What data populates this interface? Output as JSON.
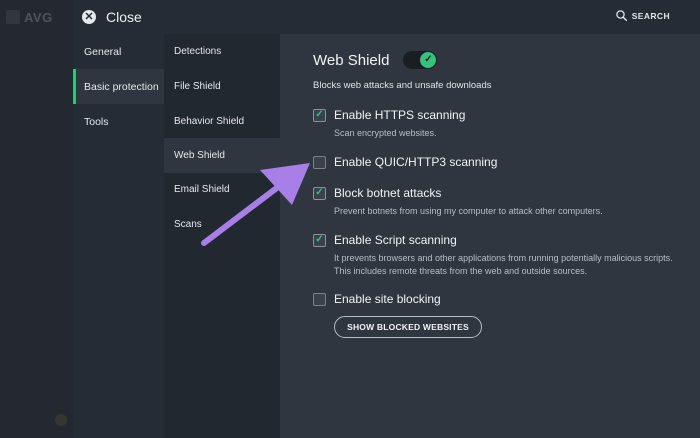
{
  "background": {
    "logo_text": "AVG"
  },
  "topbar": {
    "close_label": "Close",
    "search_label": "SEARCH"
  },
  "categories": [
    {
      "label": "General",
      "active": false
    },
    {
      "label": "Basic protection",
      "active": true
    },
    {
      "label": "Tools",
      "active": false
    }
  ],
  "subitems": [
    {
      "label": "Detections",
      "active": false
    },
    {
      "label": "File Shield",
      "active": false
    },
    {
      "label": "Behavior Shield",
      "active": false
    },
    {
      "label": "Web Shield",
      "active": true
    },
    {
      "label": "Email Shield",
      "active": false
    },
    {
      "label": "Scans",
      "active": false
    }
  ],
  "main": {
    "title": "Web Shield",
    "toggle_on": true,
    "subtitle": "Blocks web attacks and unsafe downloads",
    "options": [
      {
        "label": "Enable HTTPS scanning",
        "checked": true,
        "description": "Scan encrypted websites."
      },
      {
        "label": "Enable QUIC/HTTP3 scanning",
        "checked": false,
        "description": ""
      },
      {
        "label": "Block botnet attacks",
        "checked": true,
        "description": "Prevent botnets from using my computer to attack other computers."
      },
      {
        "label": "Enable Script scanning",
        "checked": true,
        "description": "It prevents browsers and other applications from running potentially malicious scripts. This includes remote threats from the web and outside sources."
      },
      {
        "label": "Enable site blocking",
        "checked": false,
        "description": ""
      }
    ],
    "show_blocked_label": "SHOW BLOCKED WEBSITES"
  },
  "colors": {
    "accent": "#35c27d",
    "annotation_arrow": "#a77fe6"
  },
  "icons": {
    "close": "close-icon",
    "search": "search-icon",
    "check": "check-icon",
    "toggle": "toggle-check-icon"
  }
}
